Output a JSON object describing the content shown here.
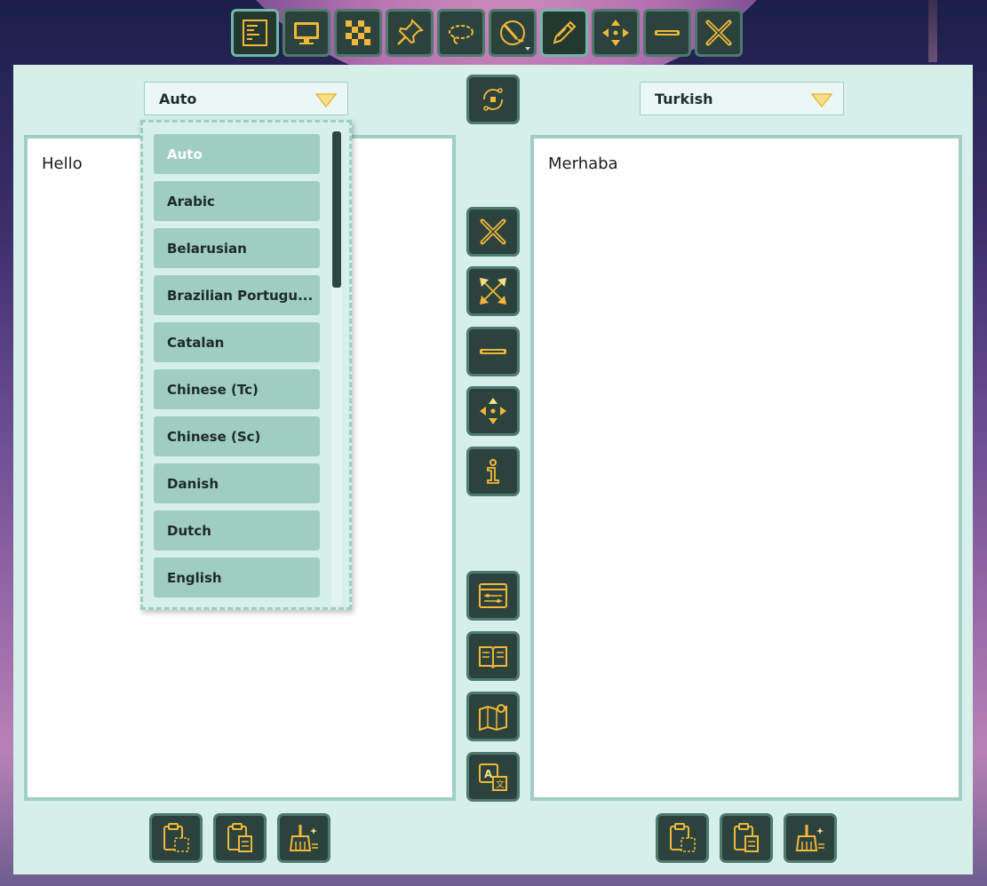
{
  "toolbar": {
    "buttons": [
      {
        "name": "text-mode-icon",
        "active": true
      },
      {
        "name": "monitor-icon",
        "active": false
      },
      {
        "name": "checkerboard-icon",
        "active": false
      },
      {
        "name": "pin-icon",
        "active": false
      },
      {
        "name": "lasso-icon",
        "active": false
      },
      {
        "name": "brush-icon",
        "active": false
      },
      {
        "name": "pencil-icon",
        "active": true
      },
      {
        "name": "move-icon",
        "active": false
      },
      {
        "name": "minimize-icon",
        "active": false
      },
      {
        "name": "close-icon",
        "active": false
      }
    ]
  },
  "source": {
    "language": "Auto",
    "text": "Hello"
  },
  "target": {
    "language": "Turkish",
    "text": "Merhaba"
  },
  "dropdown": {
    "items": [
      "Auto",
      "Arabic",
      "Belarusian",
      "Brazilian Portugu...",
      "Catalan",
      "Chinese (Tc)",
      "Chinese (Sc)",
      "Danish",
      "Dutch",
      "English"
    ],
    "selected": "Auto"
  },
  "colors": {
    "panel_bg": "#d6efe9",
    "button_bg": "#2b433c",
    "icon_accent": "#f2b73a",
    "item_bg": "#9fcdc0"
  }
}
